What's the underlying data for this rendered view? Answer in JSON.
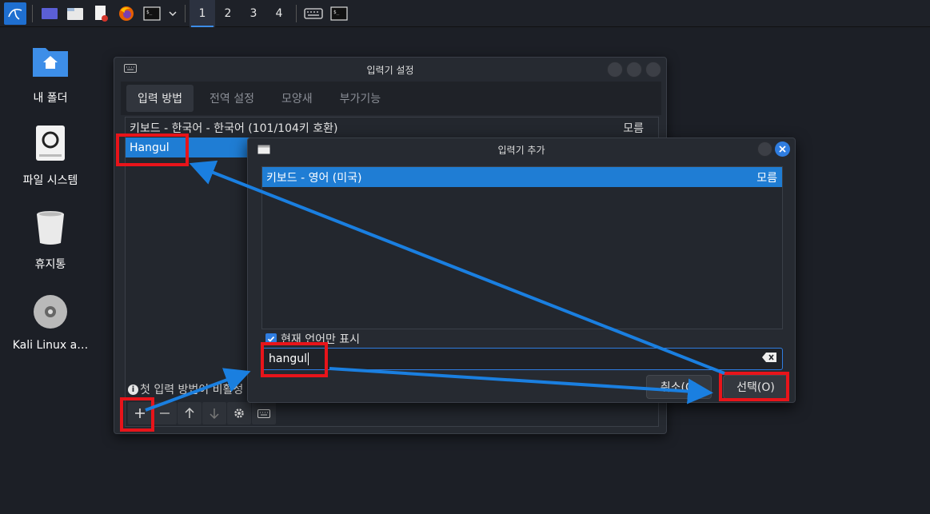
{
  "taskbar": {
    "workspaces": [
      "1",
      "2",
      "3",
      "4"
    ],
    "icons": [
      "kali-menu-icon",
      "show-desktop-icon",
      "file-manager-icon",
      "text-editor-icon",
      "firefox-icon",
      "terminal-icon",
      "chevron-down-icon",
      "keyboard-icon",
      "terminal-icon"
    ]
  },
  "desktop": {
    "items": [
      {
        "label": "내 폴더",
        "icon": "home-folder-icon"
      },
      {
        "label": "파일 시스템",
        "icon": "drive-icon"
      },
      {
        "label": "휴지통",
        "icon": "trash-icon"
      },
      {
        "label": "Kali Linux a…",
        "icon": "disc-icon"
      }
    ]
  },
  "main_window": {
    "title": "입력기 설정",
    "tabs": [
      "입력 방법",
      "전역 설정",
      "모양새",
      "부가기능"
    ],
    "active_tab": "입력 방법",
    "rows": [
      {
        "name": "키보드 - 한국어 - 한국어 (101/104키 호환)",
        "lang": "모름"
      },
      {
        "name": "Hangul",
        "lang": ""
      }
    ],
    "info_text": "첫 입력 방법이 비활성",
    "toolbar_icons": [
      "add-icon",
      "remove-icon",
      "move-up-icon",
      "move-down-icon",
      "configure-icon",
      "keyboard-layout-icon"
    ]
  },
  "add_dialog": {
    "title": "입력기 추가",
    "list": [
      {
        "name": "키보드 - 영어 (미국)",
        "lang": "모름"
      }
    ],
    "only_current_language_label": "현재 언어만 표시",
    "only_current_language_checked": true,
    "search_value": "hangul",
    "cancel_label": "취소(C)",
    "ok_label": "선택(O)"
  },
  "colors": {
    "accent": "#1f7dd4",
    "highlight_box": "#e8141a",
    "arrow": "#1a7fe0"
  }
}
